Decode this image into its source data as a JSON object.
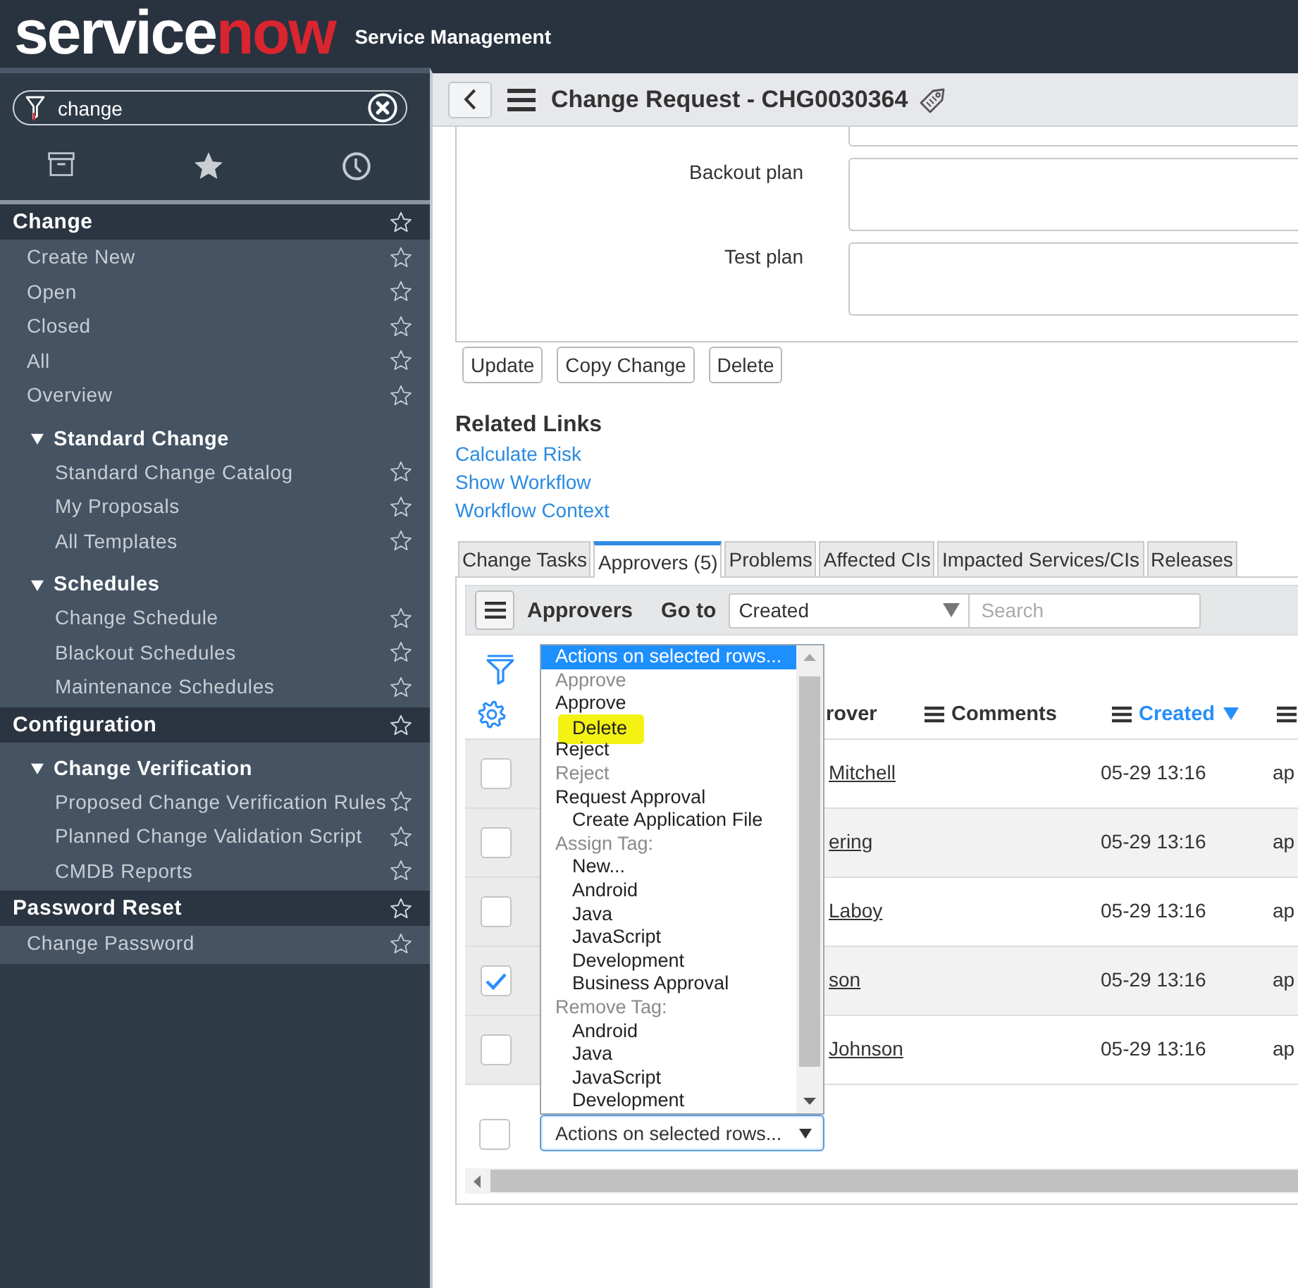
{
  "header": {
    "logo": {
      "text": "service",
      "accent": "now"
    },
    "product": "Service Management"
  },
  "navigator": {
    "filter": {
      "value": "change"
    },
    "sections": [
      {
        "title": "Change",
        "items": [
          {
            "kind": "link",
            "label": "Create New"
          },
          {
            "kind": "link",
            "label": "Open"
          },
          {
            "kind": "link",
            "label": "Closed"
          },
          {
            "kind": "link",
            "label": "All"
          },
          {
            "kind": "link",
            "label": "Overview"
          },
          {
            "kind": "group",
            "label": "Standard Change",
            "expanded": true,
            "children": [
              {
                "kind": "link",
                "label": "Standard Change Catalog"
              },
              {
                "kind": "link",
                "label": "My Proposals"
              },
              {
                "kind": "link",
                "label": "All Templates"
              }
            ]
          },
          {
            "kind": "group",
            "label": "Schedules",
            "expanded": true,
            "children": [
              {
                "kind": "link",
                "label": "Change Schedule"
              },
              {
                "kind": "link",
                "label": "Blackout Schedules"
              },
              {
                "kind": "link",
                "label": "Maintenance Schedules"
              }
            ]
          }
        ]
      },
      {
        "title": "Configuration",
        "items": [
          {
            "kind": "group",
            "label": "Change Verification",
            "expanded": true,
            "children": [
              {
                "kind": "link",
                "label": "Proposed Change Verification Rules"
              },
              {
                "kind": "link",
                "label": "Planned Change Validation Script"
              },
              {
                "kind": "link",
                "label": "CMDB Reports"
              }
            ]
          }
        ]
      },
      {
        "title": "Password Reset",
        "items": [
          {
            "kind": "link",
            "label": "Change Password"
          }
        ]
      }
    ]
  },
  "record": {
    "title": "Change Request - CHG0030364",
    "fields": [
      {
        "label": "Backout plan"
      },
      {
        "label": "Test plan"
      }
    ],
    "buttons": [
      "Update",
      "Copy Change",
      "Delete"
    ]
  },
  "related_links": {
    "title": "Related Links",
    "links": [
      "Calculate Risk",
      "Show Workflow",
      "Workflow Context"
    ]
  },
  "related_lists": {
    "tabs": [
      {
        "label": "Change Tasks",
        "selected": false
      },
      {
        "label": "Approvers (5)",
        "selected": true
      },
      {
        "label": "Problems",
        "selected": false
      },
      {
        "label": "Affected CIs",
        "selected": false
      },
      {
        "label": "Impacted Services/CIs",
        "selected": false
      },
      {
        "label": "Releases",
        "selected": false
      }
    ]
  },
  "list": {
    "title": "Approvers",
    "goto_label": "Go to",
    "goto_field": {
      "value": "Created"
    },
    "search": {
      "placeholder": "Search"
    },
    "columns": [
      {
        "label": "rover",
        "menu": false,
        "sorted": false
      },
      {
        "label": "Comments",
        "menu": true,
        "sorted": false
      },
      {
        "label": "Created",
        "menu": true,
        "sorted": true
      },
      {
        "menu": true,
        "sorted": false
      }
    ],
    "rows": [
      {
        "checked": false,
        "column_1": "Mitchell",
        "created": "05-29 13:16",
        "column_4": "ap"
      },
      {
        "checked": false,
        "column_1": "ering",
        "created": "05-29 13:16",
        "column_4": "ap"
      },
      {
        "checked": false,
        "column_1": "Laboy",
        "created": "05-29 13:16",
        "column_4": "ap"
      },
      {
        "checked": true,
        "column_1": "son",
        "created": "05-29 13:16",
        "column_4": "ap"
      },
      {
        "checked": false,
        "column_1": "Johnson",
        "created": "05-29 13:16",
        "column_4": "ap"
      }
    ],
    "select_all": {
      "checked": false
    },
    "actions": {
      "value": "Actions on selected rows...",
      "open": true,
      "options": [
        {
          "label": "Actions on selected rows...",
          "selected": true,
          "disabled": false,
          "highlighted": false
        },
        {
          "label": "Approve",
          "selected": false,
          "disabled": true,
          "highlighted": false
        },
        {
          "label": "Approve",
          "selected": false,
          "disabled": false,
          "highlighted": false,
          "children": [
            {
              "label": "Delete",
              "selected": false,
              "disabled": false,
              "highlighted": true
            }
          ]
        },
        {
          "label": "Reject",
          "selected": false,
          "disabled": false,
          "highlighted": false
        },
        {
          "label": "Reject",
          "selected": false,
          "disabled": true,
          "highlighted": false
        },
        {
          "label": "Request Approval",
          "selected": false,
          "disabled": false,
          "highlighted": false,
          "children": [
            {
              "label": "Create Application File",
              "selected": false,
              "disabled": false,
              "highlighted": false
            }
          ]
        },
        {
          "label": "Assign Tag:",
          "selected": false,
          "disabled": true,
          "highlighted": false,
          "children": [
            {
              "label": "New...",
              "selected": false,
              "disabled": false,
              "highlighted": false
            },
            {
              "label": "Android",
              "selected": false,
              "disabled": false,
              "highlighted": false
            },
            {
              "label": "Java",
              "selected": false,
              "disabled": false,
              "highlighted": false
            },
            {
              "label": "JavaScript",
              "selected": false,
              "disabled": false,
              "highlighted": false
            },
            {
              "label": "Development",
              "selected": false,
              "disabled": false,
              "highlighted": false
            },
            {
              "label": "Business Approval",
              "selected": false,
              "disabled": false,
              "highlighted": false
            }
          ]
        },
        {
          "label": "Remove Tag:",
          "selected": false,
          "disabled": true,
          "highlighted": false,
          "children": [
            {
              "label": "Android",
              "selected": false,
              "disabled": false,
              "highlighted": false
            },
            {
              "label": "Java",
              "selected": false,
              "disabled": false,
              "highlighted": false
            },
            {
              "label": "JavaScript",
              "selected": false,
              "disabled": false,
              "highlighted": false
            },
            {
              "label": "Development",
              "selected": false,
              "disabled": false,
              "highlighted": false
            }
          ]
        }
      ]
    }
  }
}
